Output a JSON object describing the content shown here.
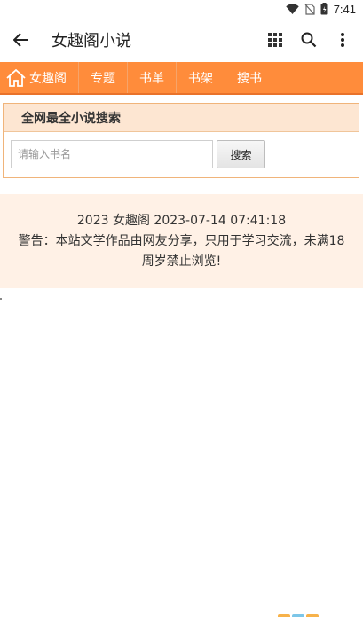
{
  "status_bar": {
    "time": "7:41"
  },
  "app_bar": {
    "title": "女趣阁小说"
  },
  "nav": {
    "items": [
      {
        "label": "女趣阁"
      },
      {
        "label": "专题"
      },
      {
        "label": "书单"
      },
      {
        "label": "书架"
      },
      {
        "label": "搜书"
      }
    ]
  },
  "search": {
    "heading": "全网最全小说搜索",
    "placeholder": "请输入书名",
    "value": "",
    "button_label": "搜索"
  },
  "notice": {
    "line1": "2023 女趣阁 2023-07-14 07:41:18",
    "line2": "警告：本站文学作品由网友分享，只用于学习交流，未满18周岁禁止浏览!"
  },
  "colors": {
    "nav_bg": "#ff8c3b",
    "search_head_bg": "#fde6d2",
    "notice_bg": "#fff1e6"
  }
}
